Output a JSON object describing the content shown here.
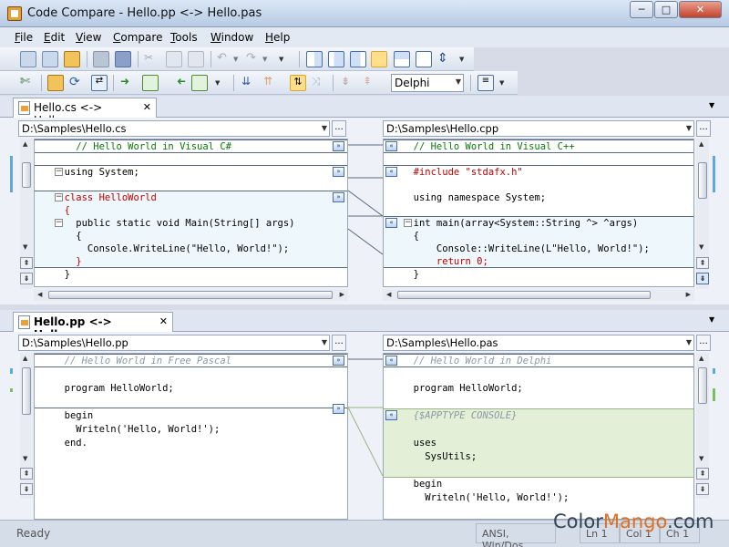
{
  "window": {
    "title": "Code Compare - Hello.pp <-> Hello.pas",
    "minimize": "─",
    "maximize": "□",
    "close": "✕"
  },
  "menu": [
    "File",
    "Edit",
    "View",
    "Compare",
    "Tools",
    "Window",
    "Help"
  ],
  "toolbar": {
    "language_value": "Delphi"
  },
  "top_tab": {
    "label": "Hello.cs <-> Hello.cpp",
    "close": "✕",
    "menu_arrow": "▼"
  },
  "bottom_tab": {
    "label": "Hello.pp <-> Hello.pas",
    "close": "✕",
    "menu_arrow": "▼"
  },
  "top_left": {
    "path": "D:\\Samples\\Hello.cs",
    "browse": "...",
    "lines": [
      {
        "text": "    // Hello World in Visual C#"
      },
      {
        "text": ""
      },
      {
        "text": "  using System;"
      },
      {
        "text": ""
      },
      {
        "text": "  class HelloWorld"
      },
      {
        "text": "  {"
      },
      {
        "text": "    public static void Main(String[] args)"
      },
      {
        "text": "    {"
      },
      {
        "text": "      Console.WriteLine(\"Hello, World!\");"
      },
      {
        "text": "    }"
      },
      {
        "text": "  }"
      }
    ]
  },
  "top_right": {
    "path": "D:\\Samples\\Hello.cpp",
    "browse": "...",
    "lines": [
      {
        "text": "  // Hello World in Visual C++"
      },
      {
        "text": ""
      },
      {
        "text": "  #include \"stdafx.h\""
      },
      {
        "text": ""
      },
      {
        "text": "  using namespace System;"
      },
      {
        "text": ""
      },
      {
        "text": "  int main(array<System::String ^> ^args)"
      },
      {
        "text": "  {"
      },
      {
        "text": "      Console::WriteLine(L\"Hello, World!\");"
      },
      {
        "text": "      return 0;"
      },
      {
        "text": "  }"
      }
    ]
  },
  "bottom_left": {
    "path": "D:\\Samples\\Hello.pp",
    "browse": "...",
    "lines": [
      {
        "text": "  // Hello World in Free Pascal"
      },
      {
        "text": ""
      },
      {
        "text": "  program HelloWorld;"
      },
      {
        "text": ""
      },
      {
        "text": "  begin"
      },
      {
        "text": "    Writeln('Hello, World!');"
      },
      {
        "text": "  end."
      }
    ]
  },
  "bottom_right": {
    "path": "D:\\Samples\\Hello.pas",
    "browse": "...",
    "lines": [
      {
        "text": "  // Hello World in Delphi"
      },
      {
        "text": ""
      },
      {
        "text": "  program HelloWorld;"
      },
      {
        "text": ""
      },
      {
        "text": "  {$APPTYPE CONSOLE}"
      },
      {
        "text": ""
      },
      {
        "text": "  uses"
      },
      {
        "text": "    SysUtils;"
      },
      {
        "text": ""
      },
      {
        "text": "  begin"
      },
      {
        "text": "    Writeln('Hello, World!');"
      }
    ]
  },
  "status": {
    "ready": "Ready",
    "encoding": "ANSI, Win/Dos",
    "ln": "Ln 1",
    "col": "Col 1",
    "ch": "Ch 1"
  },
  "watermark": {
    "text1": "Color",
    "text2": "Mango",
    "text3": ".com"
  },
  "colors": {
    "diff_highlight": "#d3ecf6",
    "insert_block": "#e3efd6",
    "changed_text": "#c00000",
    "comment": "#0a7a0a"
  }
}
